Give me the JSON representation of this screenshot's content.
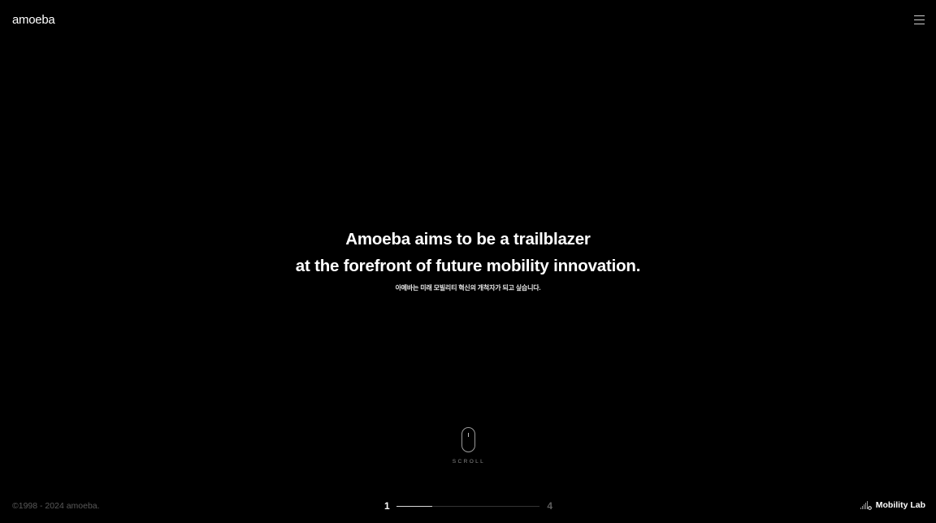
{
  "header": {
    "logo": "amoeba",
    "menu_icon": "hamburger-menu-icon"
  },
  "hero": {
    "line1": "Amoeba aims to be a trailblazer",
    "line2": "at the forefront of future mobility innovation.",
    "subtitle": "아메바는 미래 모빌리티 혁신의 개척자가 되고 싶습니다."
  },
  "scroll": {
    "icon": "mouse-scroll-icon",
    "label": "SCROLL"
  },
  "footer": {
    "copyright": "©1998 - 2024 amoeba.",
    "pager": {
      "current": "1",
      "total": "4",
      "progress": 0.25
    },
    "mobility_lab": {
      "icon": "signal-bars-icon",
      "label": "Mobility Lab"
    }
  },
  "colors": {
    "background": "#000000",
    "text": "#ffffff",
    "muted": "#5a5a5a"
  }
}
